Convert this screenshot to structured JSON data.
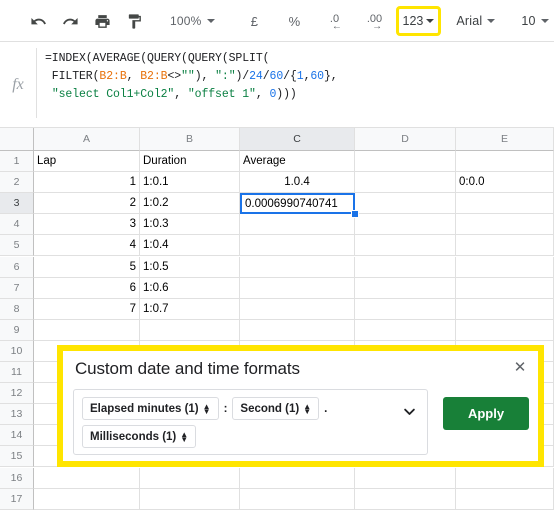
{
  "toolbar": {
    "undo": "undo-icon",
    "redo": "redo-icon",
    "print": "print-icon",
    "paint_format": "paint-format-icon",
    "zoom_value": "100%",
    "currency": "£",
    "percent": "%",
    "decrease_decimal": ".0",
    "increase_decimal": ".00",
    "number_format": "123",
    "font_name": "Arial",
    "font_size": "10"
  },
  "formula_bar": {
    "fx_label": "fx",
    "lines": [
      {
        "segments": [
          {
            "t": "=INDEX(AVERAGE(QUERY(QUERY(SPLIT(",
            "k": "plain"
          }
        ]
      },
      {
        "segments": [
          {
            "t": " FILTER(",
            "k": "plain"
          },
          {
            "t": "B2:B",
            "k": "ref"
          },
          {
            "t": ", ",
            "k": "plain"
          },
          {
            "t": "B2:B",
            "k": "ref"
          },
          {
            "t": "<>",
            "k": "plain"
          },
          {
            "t": "\"\"",
            "k": "str"
          },
          {
            "t": "), ",
            "k": "plain"
          },
          {
            "t": "\":\"",
            "k": "str"
          },
          {
            "t": ")/",
            "k": "plain"
          },
          {
            "t": "24",
            "k": "num"
          },
          {
            "t": "/",
            "k": "plain"
          },
          {
            "t": "60",
            "k": "num"
          },
          {
            "t": "/{",
            "k": "plain"
          },
          {
            "t": "1",
            "k": "num"
          },
          {
            "t": ",",
            "k": "plain"
          },
          {
            "t": "60",
            "k": "num"
          },
          {
            "t": "},",
            "k": "plain"
          }
        ]
      },
      {
        "segments": [
          {
            "t": " ",
            "k": "plain"
          },
          {
            "t": "\"select Col1+Col2\"",
            "k": "str"
          },
          {
            "t": ", ",
            "k": "plain"
          },
          {
            "t": "\"offset 1\"",
            "k": "str"
          },
          {
            "t": ", ",
            "k": "plain"
          },
          {
            "t": "0",
            "k": "num"
          },
          {
            "t": ")))",
            "k": "plain"
          }
        ]
      }
    ]
  },
  "grid": {
    "columns": [
      "A",
      "B",
      "C",
      "D",
      "E"
    ],
    "selected_column": "C",
    "selected_row": "3",
    "rows": [
      "1",
      "2",
      "3",
      "4",
      "5",
      "6",
      "7",
      "8",
      "9",
      "10",
      "11",
      "12",
      "13",
      "14",
      "15",
      "16",
      "17"
    ],
    "cells": [
      {
        "row": 1,
        "col": "A",
        "value": "Lap",
        "align": "left"
      },
      {
        "row": 1,
        "col": "B",
        "value": "Duration",
        "align": "left"
      },
      {
        "row": 1,
        "col": "C",
        "value": "Average",
        "align": "left"
      },
      {
        "row": 2,
        "col": "A",
        "value": "1",
        "align": "right"
      },
      {
        "row": 2,
        "col": "B",
        "value": "1:0.1",
        "align": "left"
      },
      {
        "row": 2,
        "col": "C",
        "value": "1.0.4",
        "align": "center"
      },
      {
        "row": 2,
        "col": "E",
        "value": "0:0.0",
        "align": "left"
      },
      {
        "row": 3,
        "col": "A",
        "value": "2",
        "align": "right"
      },
      {
        "row": 3,
        "col": "B",
        "value": "1:0.2",
        "align": "left"
      },
      {
        "row": 4,
        "col": "A",
        "value": "3",
        "align": "right"
      },
      {
        "row": 4,
        "col": "B",
        "value": "1:0.3",
        "align": "left"
      },
      {
        "row": 5,
        "col": "A",
        "value": "4",
        "align": "right"
      },
      {
        "row": 5,
        "col": "B",
        "value": "1:0.4",
        "align": "left"
      },
      {
        "row": 6,
        "col": "A",
        "value": "5",
        "align": "right"
      },
      {
        "row": 6,
        "col": "B",
        "value": "1:0.5",
        "align": "left"
      },
      {
        "row": 7,
        "col": "A",
        "value": "6",
        "align": "right"
      },
      {
        "row": 7,
        "col": "B",
        "value": "1:0.6",
        "align": "left"
      },
      {
        "row": 8,
        "col": "A",
        "value": "7",
        "align": "right"
      },
      {
        "row": 8,
        "col": "B",
        "value": "1:0.7",
        "align": "left"
      }
    ],
    "active_cell": {
      "row": 3,
      "col": "C",
      "value": "0.0006990740741"
    }
  },
  "dialog": {
    "title": "Custom date and time formats",
    "close_label": "✕",
    "chips_row1": [
      {
        "label": "Elapsed minutes (1)"
      },
      {
        "label": "Second (1)"
      }
    ],
    "separator_1": ":",
    "separator_2": ".",
    "chips_row2": [
      {
        "label": "Milliseconds (1)"
      }
    ],
    "apply_label": "Apply",
    "accent_green": "#188038",
    "highlight_yellow": "#ffe500"
  }
}
